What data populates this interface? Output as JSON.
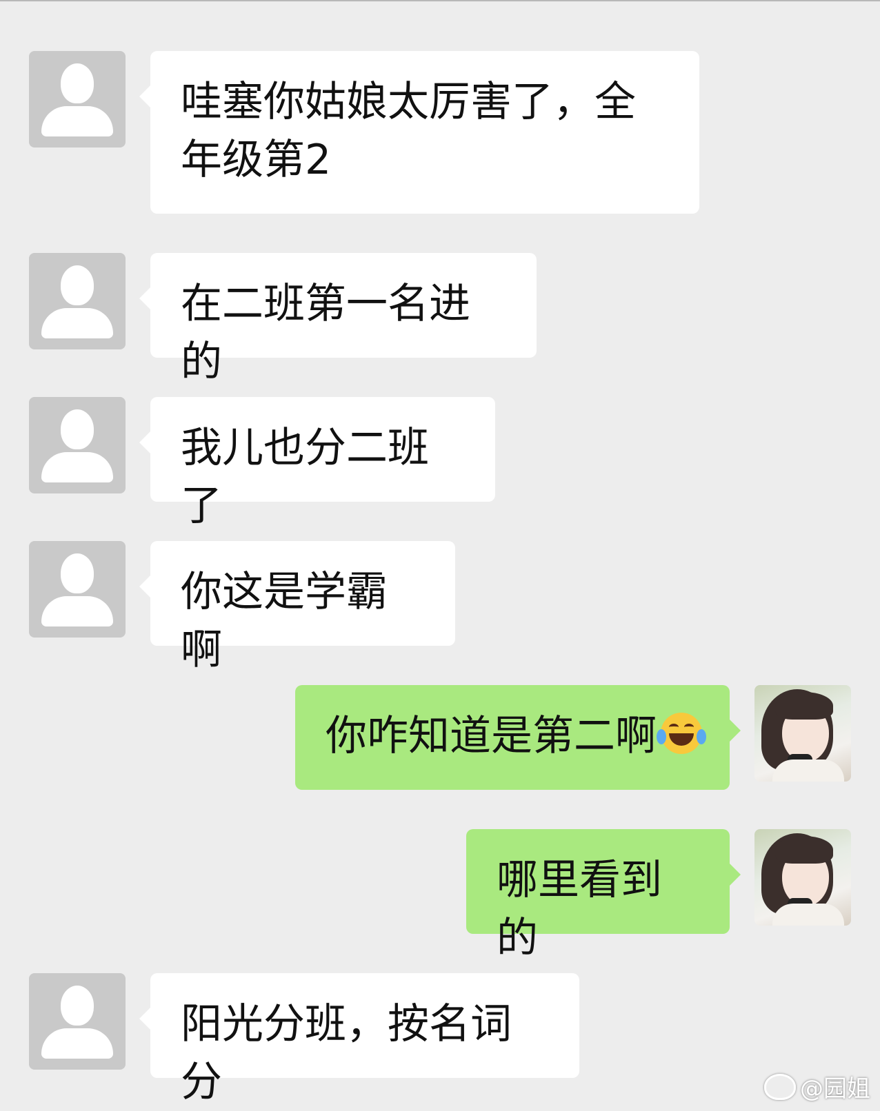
{
  "messages": [
    {
      "side": "left",
      "avatar": "default-user-icon",
      "text": "哇塞你姑娘太厉害了，全年级第2"
    },
    {
      "side": "left",
      "avatar": "default-user-icon",
      "text": "在二班第一名进的"
    },
    {
      "side": "left",
      "avatar": "default-user-icon",
      "text": "我儿也分二班了"
    },
    {
      "side": "left",
      "avatar": "default-user-icon",
      "text": "你这是学霸啊"
    },
    {
      "side": "right",
      "avatar": "user-photo-avatar",
      "text": "你咋知道是第二啊",
      "emoji": "tears-of-joy-emoji"
    },
    {
      "side": "right",
      "avatar": "user-photo-avatar",
      "text": "哪里看到的"
    },
    {
      "side": "left",
      "avatar": "default-user-icon",
      "text": "阳光分班，按名词分"
    }
  ],
  "watermark": {
    "text": "@园姐",
    "icon": "weibo-icon"
  },
  "colors": {
    "background": "#ededed",
    "incoming_bubble": "#ffffff",
    "outgoing_bubble": "#a9e97f",
    "default_avatar": "#c9c9c9"
  }
}
